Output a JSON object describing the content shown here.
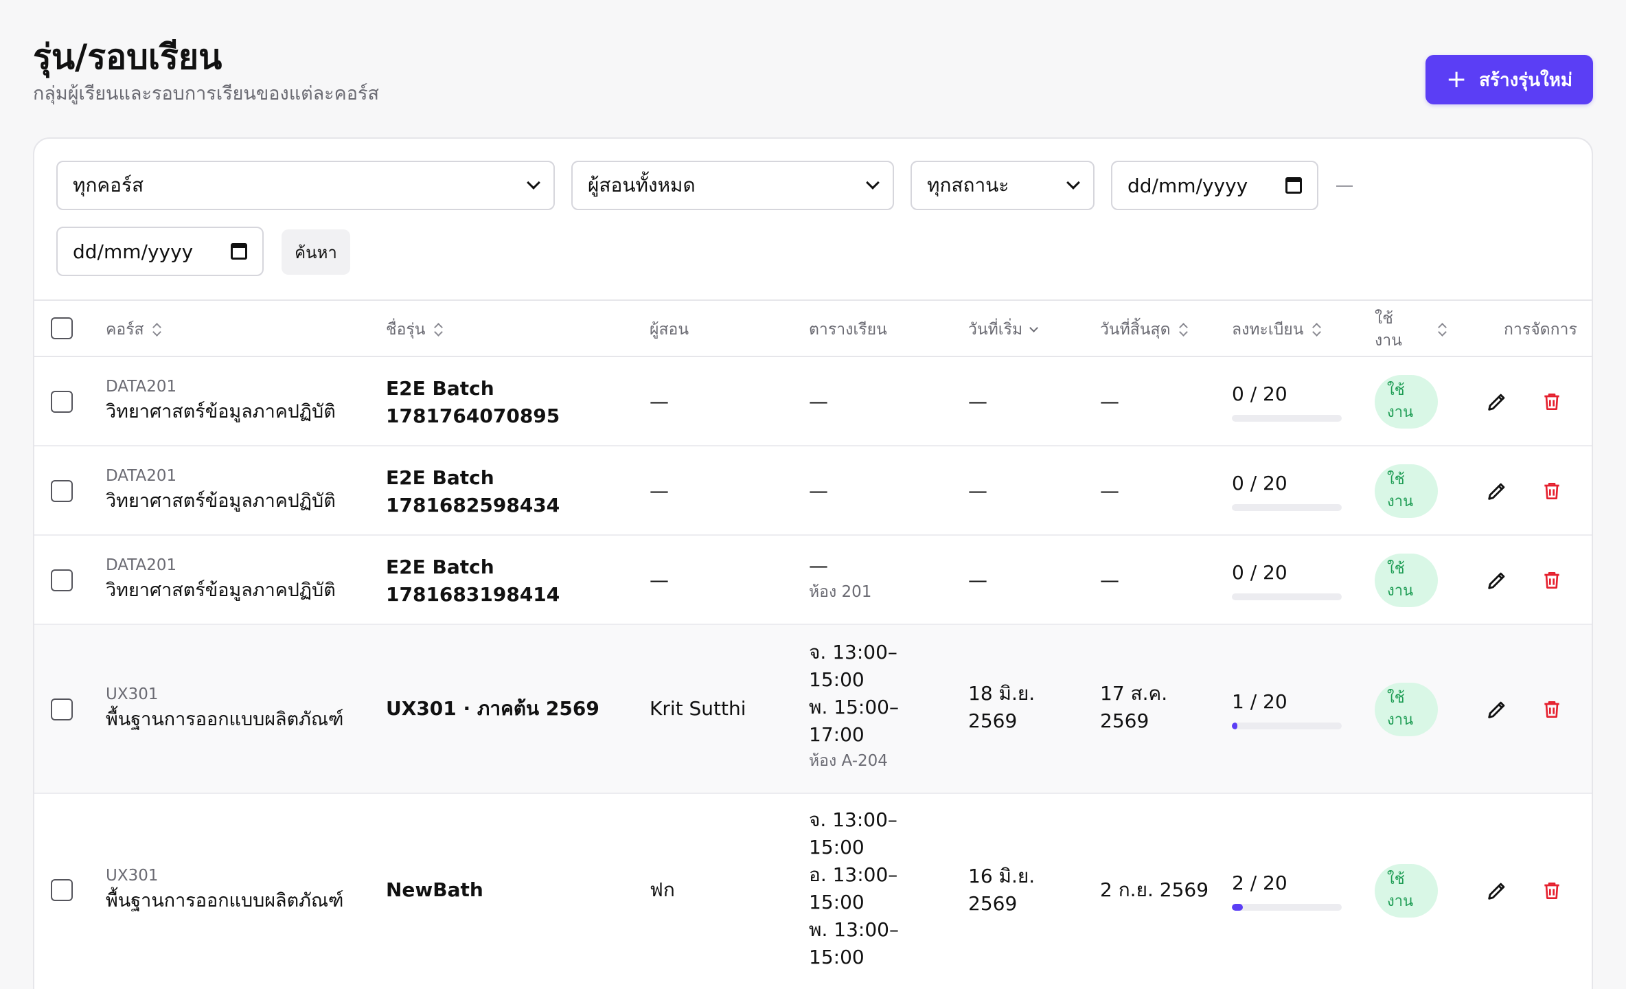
{
  "header": {
    "title": "รุ่น/รอบเรียน",
    "subtitle": "กลุ่มผู้เรียนและรอบการเรียนของแต่ละคอร์ส",
    "create_label": "สร้างรุ่นใหม่"
  },
  "filters": {
    "course": "ทุกคอร์ส",
    "instructor": "ผู้สอนทั้งหมด",
    "status": "ทุกสถานะ",
    "date_from_placeholder": "dd/mm/yyyy",
    "date_to_placeholder": "dd/mm/yyyy",
    "search_label": "ค้นหา"
  },
  "table": {
    "headers": {
      "course": "คอร์ส",
      "batch": "ชื่อรุ่น",
      "instructor": "ผู้สอน",
      "schedule": "ตารางเรียน",
      "start": "วันที่เริ่ม",
      "end": "วันที่สิ้นสุด",
      "enrolled": "ลงทะเบียน",
      "active_1": "ใช้",
      "active_2": "งาน",
      "actions": "การจัดการ"
    },
    "rows": [
      {
        "code": "DATA201",
        "course_name": "วิทยาศาสตร์ข้อมูลภาคปฏิบัติ",
        "batch_1": "E2E Batch",
        "batch_2": "1781764070895",
        "instructor": "—",
        "schedule_1": "—",
        "start": "—",
        "end": "—",
        "enrolled": "0 / 20",
        "enrolled_fraction": 0,
        "badge_1": "ใช้",
        "badge_2": "งาน"
      },
      {
        "code": "DATA201",
        "course_name": "วิทยาศาสตร์ข้อมูลภาคปฏิบัติ",
        "batch_1": "E2E Batch",
        "batch_2": "1781682598434",
        "instructor": "—",
        "schedule_1": "—",
        "start": "—",
        "end": "—",
        "enrolled": "0 / 20",
        "enrolled_fraction": 0,
        "badge_1": "ใช้",
        "badge_2": "งาน"
      },
      {
        "code": "DATA201",
        "course_name": "วิทยาศาสตร์ข้อมูลภาคปฏิบัติ",
        "batch_1": "E2E Batch",
        "batch_2": "1781683198414",
        "instructor": "—",
        "schedule_1": "—",
        "room": "ห้อง 201",
        "start": "—",
        "end": "—",
        "enrolled": "0 / 20",
        "enrolled_fraction": 0,
        "badge_1": "ใช้",
        "badge_2": "งาน"
      },
      {
        "code": "UX301",
        "course_name": "พื้นฐานการออกแบบผลิตภัณฑ์",
        "batch_1": "UX301 · ภาคต้น 2569",
        "instructor": "Krit Sutthi",
        "schedule_1": "จ. 13:00–",
        "schedule_2": "15:00",
        "schedule_3": "พ. 15:00–",
        "schedule_4": "17:00",
        "room": "ห้อง A-204",
        "start_1": "18 มิ.ย.",
        "start_2": "2569",
        "end_1": "17 ส.ค.",
        "end_2": "2569",
        "enrolled": "1 / 20",
        "enrolled_fraction": 0.05,
        "badge_1": "ใช้",
        "badge_2": "งาน"
      },
      {
        "code": "UX301",
        "course_name": "พื้นฐานการออกแบบผลิตภัณฑ์",
        "batch_1": "NewBath",
        "instructor": "ฟก",
        "schedule_1": "จ. 13:00–",
        "schedule_2": "15:00",
        "schedule_3": "อ. 13:00–",
        "schedule_4": "15:00",
        "schedule_5": "พ. 13:00–",
        "schedule_6": "15:00",
        "start_1": "16 มิ.ย.",
        "start_2": "2569",
        "end": "2 ก.ย. 2569",
        "enrolled": "2 / 20",
        "enrolled_fraction": 0.1,
        "badge_1": "ใช้",
        "badge_2": "งาน"
      }
    ]
  },
  "colors": {
    "accent": "#5b3ef5",
    "danger": "#e5202e",
    "success_bg": "#d9f7e6",
    "success_text": "#1f9d55"
  },
  "icons": {
    "create": "plus-icon",
    "edit": "pencil-icon",
    "delete": "trash-icon",
    "date": "calendar-icon"
  }
}
